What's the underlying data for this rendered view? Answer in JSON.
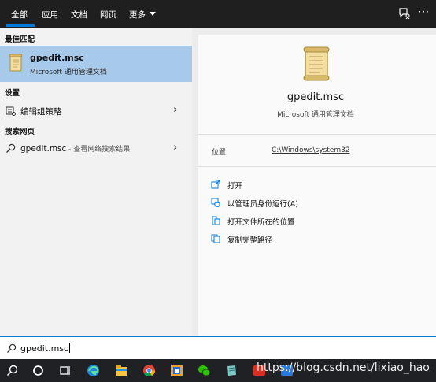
{
  "tabs": [
    {
      "label": "全部",
      "active": true
    },
    {
      "label": "应用"
    },
    {
      "label": "文档"
    },
    {
      "label": "网页"
    },
    {
      "label": "更多"
    }
  ],
  "topbar": {
    "more_menu_label": "···"
  },
  "left": {
    "best_match_heading": "最佳匹配",
    "best_match": {
      "title": "gpedit.msc",
      "subtitle": "Microsoft 通用管理文档"
    },
    "settings_heading": "设置",
    "settings_item": {
      "label": "编辑组策略"
    },
    "web_heading": "搜索网页",
    "web_item": {
      "query": "gpedit.msc",
      "hint": " - 查看网络搜索结果"
    }
  },
  "detail": {
    "title": "gpedit.msc",
    "subtitle": "Microsoft 通用管理文档",
    "location_label": "位置",
    "location_value": "C:\\Windows\\system32",
    "actions": [
      {
        "label": "打开",
        "icon": "open-icon"
      },
      {
        "label": "以管理员身份运行(A)",
        "icon": "admin-shield-icon"
      },
      {
        "label": "打开文件所在的位置",
        "icon": "file-location-icon"
      },
      {
        "label": "复制完整路径",
        "icon": "copy-path-icon"
      }
    ]
  },
  "search": {
    "value": "gpedit.msc"
  },
  "watermark": "https://blog.csdn.net/lixiao_hao",
  "colors": {
    "accent": "#0078d7",
    "selected_row": "#a7caea",
    "topbar": "#1f1f1f",
    "taskbar": "#202124"
  }
}
